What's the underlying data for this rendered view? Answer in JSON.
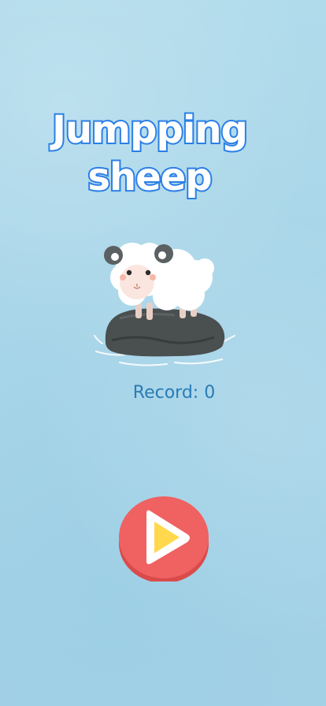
{
  "game": {
    "title_line1": "Jumpping",
    "title_line2": "sheep"
  },
  "record": {
    "label": "Record: 0"
  },
  "play_button": {
    "icon": "play-icon",
    "color": "#f06161"
  },
  "colors": {
    "background": "#a9d7ea",
    "title_outline": "#2b7fe6",
    "record_text": "#2a7bb5"
  }
}
